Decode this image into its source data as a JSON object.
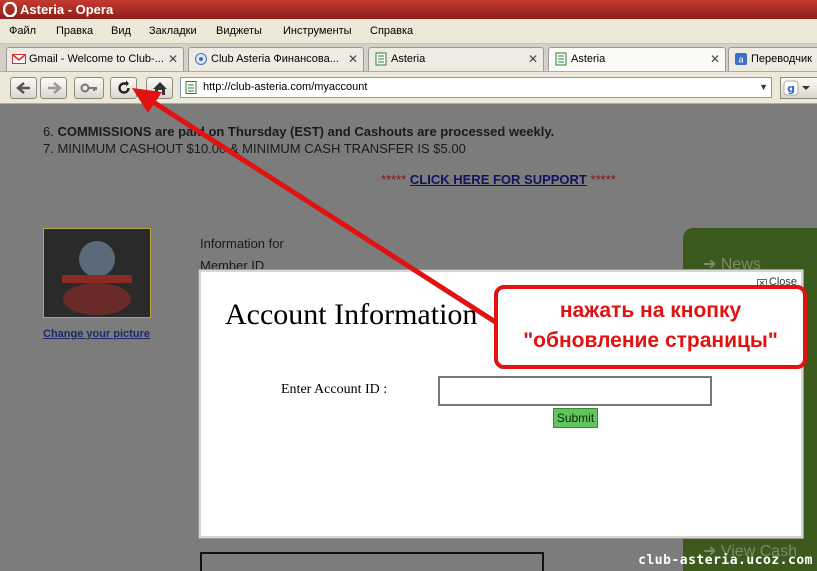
{
  "window": {
    "title": "Asteria - Opera"
  },
  "menu": [
    "Файл",
    "Правка",
    "Вид",
    "Закладки",
    "Виджеты",
    "Инструменты",
    "Справка"
  ],
  "tabs": [
    {
      "label": "Gmail - Welcome to Club-...",
      "icon": "gmail-icon",
      "close": "✕"
    },
    {
      "label": "Club Asteria Финансова...",
      "icon": "site-icon",
      "close": "✕"
    },
    {
      "label": "Asteria",
      "icon": "page-icon",
      "close": "✕"
    },
    {
      "label": "Asteria",
      "icon": "page-icon",
      "close": "✕",
      "active": true
    },
    {
      "label": "Переводчик",
      "icon": "translate-icon"
    }
  ],
  "address": {
    "url": "http://club-asteria.com/myaccount"
  },
  "page": {
    "line6_prefix": "6. ",
    "line6": "COMMISSIONS are paid on Thursday (EST) and Cashouts are processed weekly.",
    "line7": "7. MINIMUM CASHOUT $10.00 & MINIMUM CASH TRANSFER IS $5.00",
    "support_stars": "*****",
    "support_link": "CLICK HERE FOR SUPPORT",
    "change_picture": "Change your picture",
    "info_for": "Information for",
    "member_id": "Member ID",
    "sidebar": [
      "News",
      "View Cash"
    ]
  },
  "modal": {
    "close": "Close",
    "title": "Account Information",
    "account_label": "Enter Account ID :",
    "account_value": "",
    "submit": "Submit"
  },
  "annotation": {
    "line1": "нажать на кнопку",
    "line2": "\"обновление страницы\""
  },
  "watermark": "club-asteria.ucoz.com",
  "colors": {
    "annotation": "#e11212",
    "submit": "#62c45c",
    "titlebar": "#b5302a"
  }
}
